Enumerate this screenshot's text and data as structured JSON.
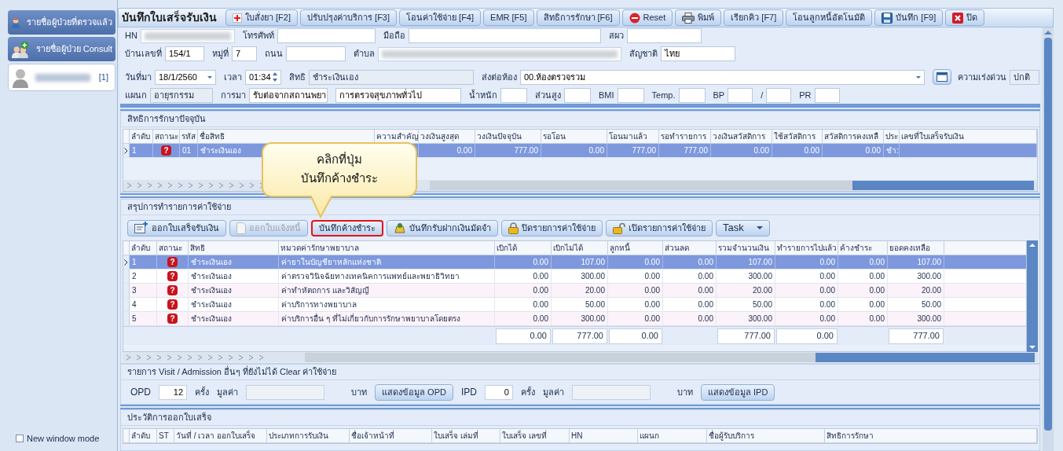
{
  "sidebar": {
    "items": [
      {
        "label": "รายชื่อผู้ป่วยที่ตรวจแล้ว",
        "selected": false
      },
      {
        "label": "รายชื่อผู้ป่วย Consult",
        "selected": false
      },
      {
        "label": "[1]",
        "selected": true
      }
    ],
    "new_window_mode": {
      "label": "New window mode",
      "checked": false
    }
  },
  "toolbar": {
    "title": "บันทึกใบเสร็จรับเงิน",
    "buttons": [
      {
        "label": "ใบสั่งยา [F2]"
      },
      {
        "label": "ปรับปรุงค่าบริการ [F3]"
      },
      {
        "label": "โอนค่าใช้จ่าย [F4]"
      },
      {
        "label": "EMR [F5]"
      },
      {
        "label": "สิทธิการรักษา [F6]"
      },
      {
        "label": "Reset"
      },
      {
        "label": "พิมพ์"
      },
      {
        "label": "เรียกคิว [F7]"
      },
      {
        "label": "โอนลูกหนี้อัตโนมัติ"
      },
      {
        "label": "บันทึก [F9]"
      },
      {
        "label": "ปิด"
      }
    ]
  },
  "patient_info": {
    "rows": [
      {
        "fields": [
          {
            "label": "HN",
            "kind": "blur"
          },
          {
            "label": "โทรศัพท์",
            "kind": "text"
          },
          {
            "label": "มือถือ",
            "kind": "text"
          },
          {
            "label": "สผว",
            "kind": "text"
          }
        ]
      },
      {
        "fields": [
          {
            "label": "บ้านเลขที่",
            "kind": "text",
            "value": "154/1"
          },
          {
            "label": "หมู่ที่",
            "kind": "text",
            "value": "7"
          },
          {
            "label": "ถนน",
            "kind": "text"
          },
          {
            "label": "ตำบล",
            "kind": "blur"
          },
          {
            "label": "สัญชาติ",
            "kind": "text",
            "value": "ไทย"
          }
        ]
      },
      {
        "fields": [
          {
            "label": "วันที่มา",
            "kind": "date",
            "value": "18/1/2560"
          },
          {
            "label": "เวลา",
            "kind": "time",
            "value": "01:34"
          },
          {
            "label": "สิทธิ",
            "kind": "readonly",
            "value": "ชำระเงินเอง"
          },
          {
            "label": "ส่งต่อห้อง",
            "kind": "combo",
            "value": "00.ห้องตรวจรวม"
          },
          {
            "label": "ความเร่งด่วน",
            "kind": "readonly",
            "value": "ปกติ"
          }
        ]
      },
      {
        "fields": [
          {
            "label": "แผนก",
            "kind": "readonly",
            "value": "อายุรกรรม"
          },
          {
            "label": "การมา",
            "kind": "text",
            "value": "รับต่อจากสถานพยา"
          },
          {
            "kind": "text",
            "value": "การตรวจสุขภาพทั่วไป"
          },
          {
            "label": "น้ำหนัก",
            "kind": "text"
          },
          {
            "label": "ส่วนสูง",
            "kind": "text"
          },
          {
            "label": "BMI",
            "kind": "text"
          },
          {
            "label": "Temp.",
            "kind": "text"
          },
          {
            "label": "BP",
            "kind": "text"
          },
          {
            "label": "/",
            "kind": "text"
          },
          {
            "label": "PR",
            "kind": "text"
          }
        ]
      }
    ]
  },
  "rights": {
    "title": "สิทธิการรักษาปัจจุบัน",
    "columns": [
      "ลำดับ",
      "สถานะ",
      "รหัส",
      "ชื่อสิทธิ",
      "ความสำคัญ",
      "วงเงินสูงสุด",
      "วงเงินปัจจุบัน",
      "รอโอน",
      "โอนมาแล้ว",
      "รอทำรายการ",
      "วงเงินสวัสดิการ",
      "ใช้สวัสดิการ",
      "สวัสดิการคงเหลื",
      "ประ",
      "เลขที่ใบเสร็จรับเงิน"
    ],
    "rows": [
      {
        "selected": true,
        "cells": [
          "1",
          "?",
          "01",
          "ชำระเงินเอง",
          null,
          "0.00",
          "777.00",
          "0.00",
          "777.00",
          "777.00",
          "0.00",
          "0.00",
          "0.00",
          "ชำ:",
          null
        ]
      }
    ]
  },
  "callout": {
    "lines": [
      "คลิกที่ปุ่ม",
      "บันทึกค้างชำระ"
    ]
  },
  "expenses": {
    "title": "สรุปการทำรายการค่าใช้จ่าย",
    "buttons": [
      {
        "label": "ออกใบเสร็จรับเงิน",
        "disabled": false,
        "highlighted": false
      },
      {
        "label": "ออกใบแจ้งหนี้",
        "disabled": true,
        "highlighted": false
      },
      {
        "label": "บันทึกค้างชำระ",
        "disabled": false,
        "highlighted": true
      },
      {
        "label": "บันทึกรับฝากเงินมัดจำ",
        "disabled": false,
        "highlighted": false
      },
      {
        "label": "ปิดรายการค่าใช้จ่าย",
        "disabled": false,
        "highlighted": false
      },
      {
        "label": "เปิดรายการค่าใช้จ่าย",
        "disabled": false,
        "highlighted": false
      }
    ],
    "task": {
      "label": "Task"
    },
    "columns": [
      "ลำดับ",
      "สถานะ",
      "สิทธิ",
      "หมวดค่ารักษาพยาบาล",
      "เบิกได้",
      "เบิกไม่ได้",
      "ลูกหนี้",
      "ส่วนลด",
      "รวมจำนวนเงิน",
      "ทำรายการไปแล้ว",
      "ค้างชำระ",
      "ยอดคงเหลือ"
    ],
    "rows": [
      {
        "selected": true,
        "cells": [
          "1",
          "?",
          "ชำระเงินเอง",
          "ค่ายาในบัญชียาหลักแห่งชาติ",
          "0.00",
          "107.00",
          "0.00",
          "0.00",
          "107.00",
          "0.00",
          "0.00",
          "107.00"
        ]
      },
      {
        "selected": false,
        "cells": [
          "2",
          "?",
          "ชำระเงินเอง",
          "ค่าตรวจวินิจฉัยทางเทคนิคการแพทย์และพยาธิวิทยา",
          "0.00",
          "300.00",
          "0.00",
          "0.00",
          "300.00",
          "0.00",
          "0.00",
          "300.00"
        ]
      },
      {
        "selected": false,
        "cells": [
          "3",
          "?",
          "ชำระเงินเอง",
          "ค่าทำหัตถการ และวิสัญญี",
          "0.00",
          "20.00",
          "0.00",
          "0.00",
          "20.00",
          "0.00",
          "0.00",
          "20.00"
        ]
      },
      {
        "selected": false,
        "cells": [
          "4",
          "?",
          "ชำระเงินเอง",
          "ค่าบริการทางพยาบาล",
          "0.00",
          "50.00",
          "0.00",
          "0.00",
          "50.00",
          "0.00",
          "0.00",
          "50.00"
        ]
      },
      {
        "selected": false,
        "cells": [
          "5",
          "?",
          "ชำระเงินเอง",
          "ค่าบริการอื่น ๆ ที่ไม่เกี่ยวกับการรักษาพยาบาลโดยตรง",
          "0.00",
          "300.00",
          "0.00",
          "0.00",
          "300.00",
          "0.00",
          "0.00",
          "300.00"
        ]
      }
    ],
    "totals": [
      "0.00",
      "777.00",
      "0.00",
      "777.00",
      "0.00",
      "777.00"
    ]
  },
  "visits": {
    "title": "รายการ Visit / Admission อื่นๆ ที่ยังไม่ได้ Clear ค่าใช้จ่าย",
    "groups": [
      {
        "type": "OPD",
        "count": "12",
        "times": "ครั้ง",
        "value_label": "มูลค่า",
        "unit": "บาท",
        "button": "แสดงข้อมูล OPD"
      },
      {
        "type": "IPD",
        "count": "0",
        "times": "ครั้ง",
        "value_label": "มูลค่า",
        "unit": "บาท",
        "button": "แสดงข้อมูล IPD"
      }
    ]
  },
  "history": {
    "title": "ประวัติการออกใบเสร็จ",
    "columns": [
      "ลำดับ",
      "ST",
      "วันที่ / เวลา ออกใบเสร็จ",
      "ประเภทการรับเงิน",
      "ชื่อเจ้าหน้าที่",
      "ใบเสร็จ เล่มที่",
      "ใบเสร็จ เลขที่",
      "HN",
      "แผนก",
      "ชื่อผู้รับบริการ",
      "สิทธิการรักษา"
    ]
  }
}
